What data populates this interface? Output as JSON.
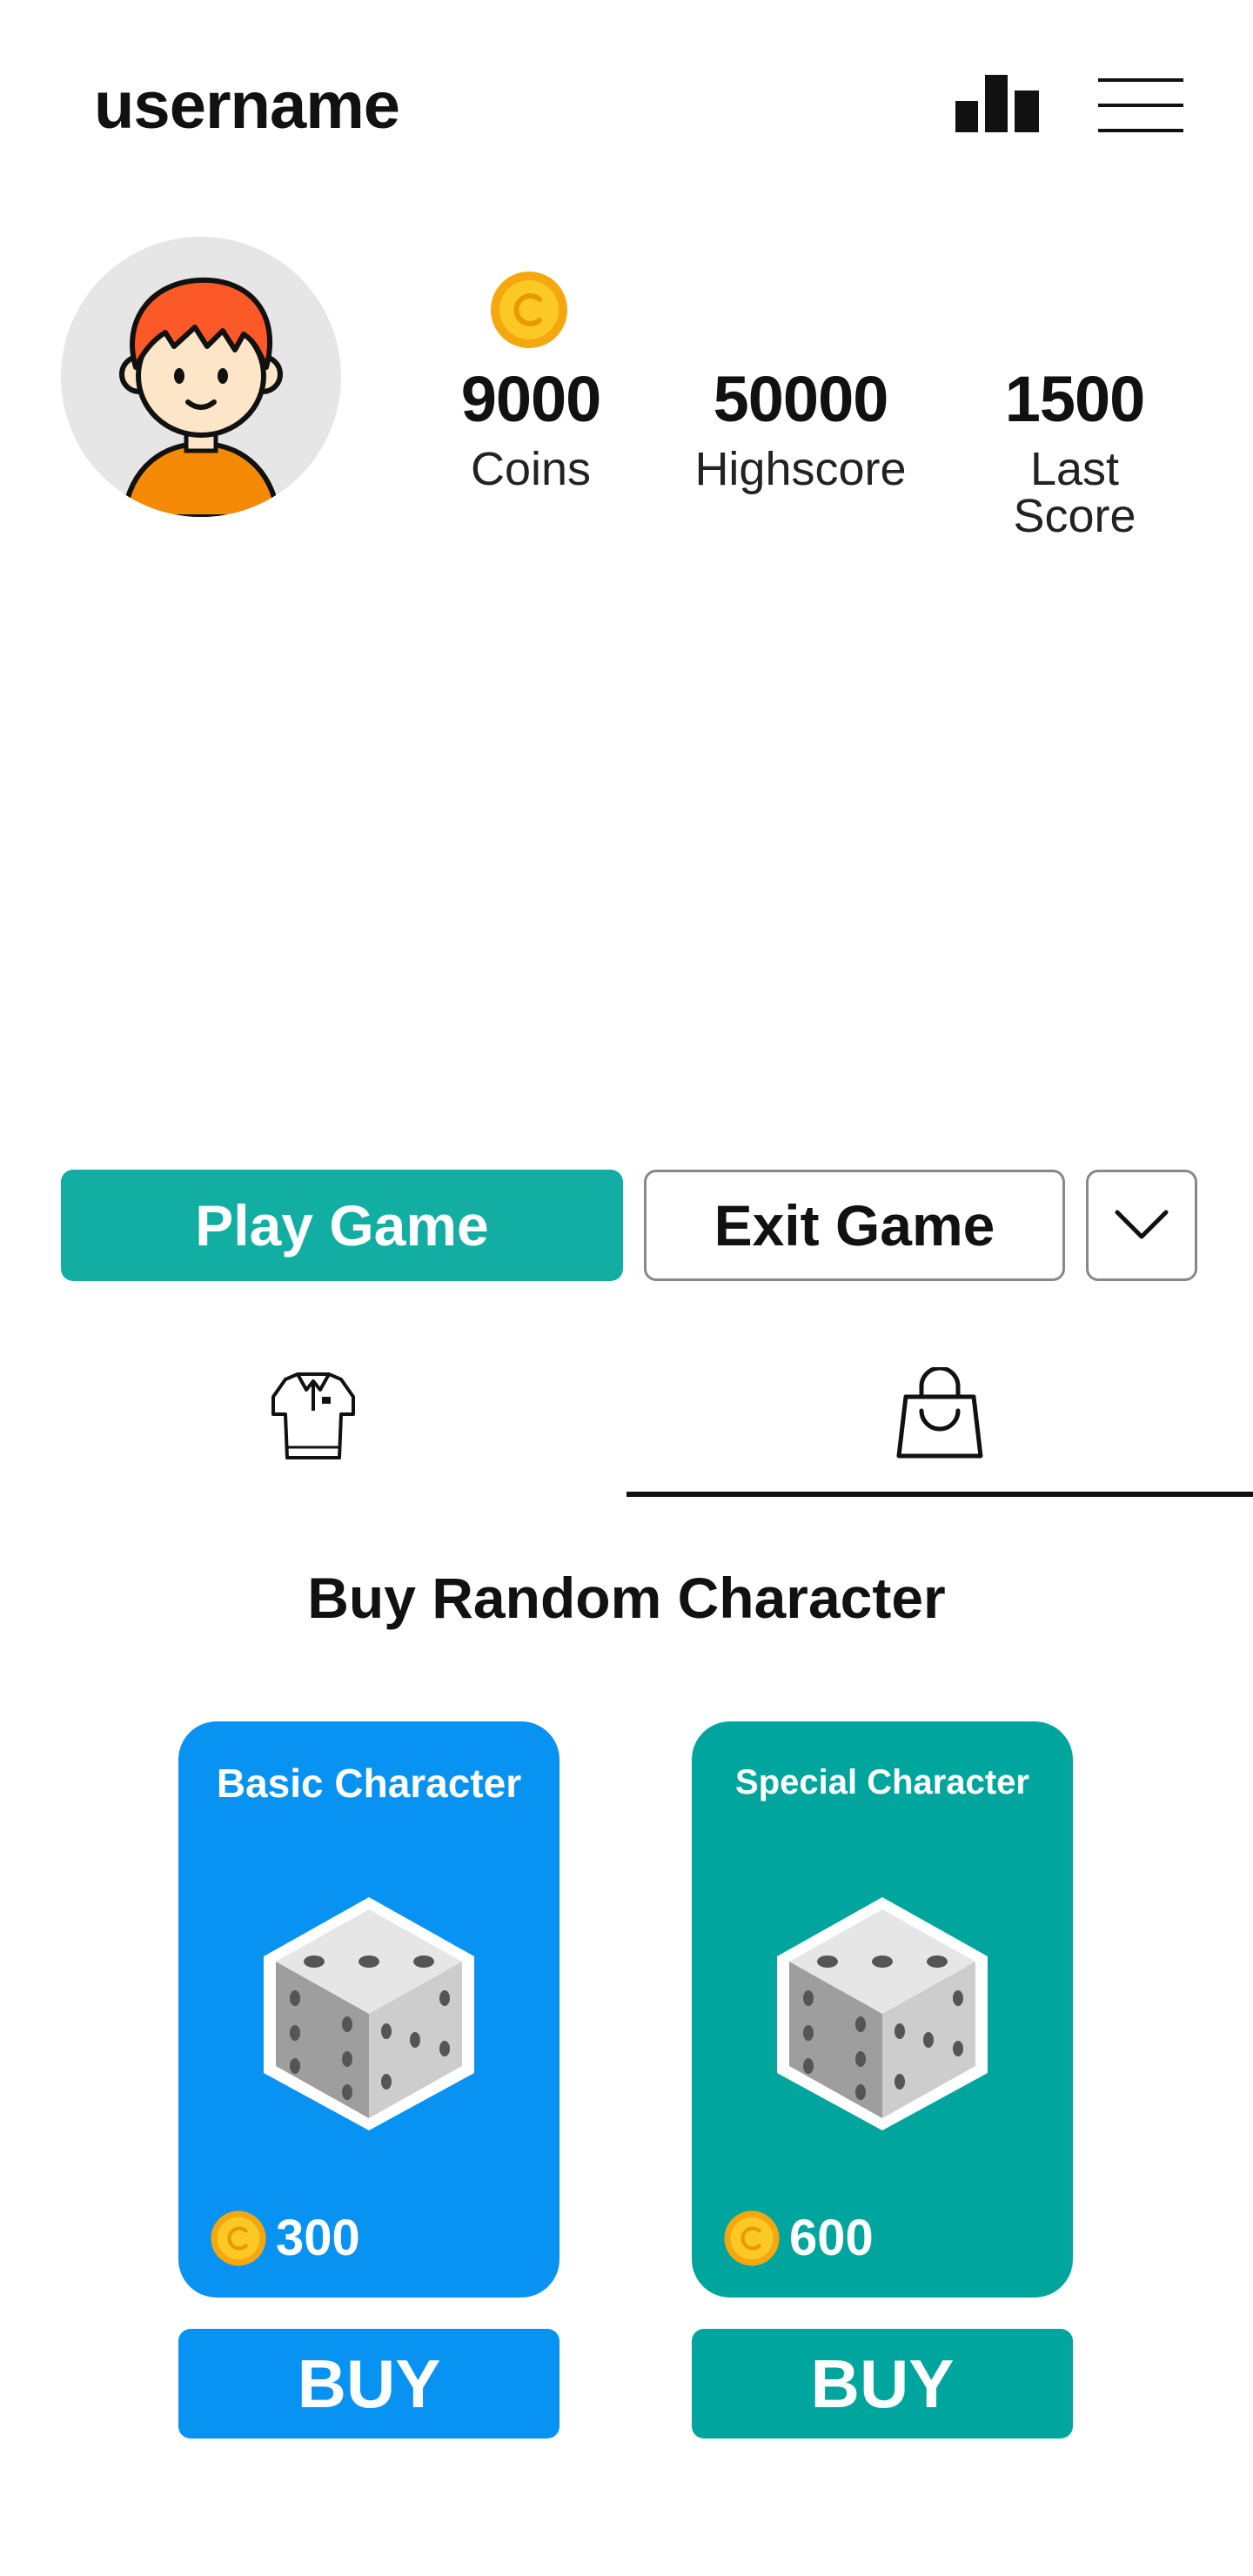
{
  "header": {
    "username": "username",
    "leaderboard_icon": "leaderboard-bar-chart-icon",
    "menu_icon": "hamburger-menu-icon"
  },
  "profile": {
    "avatar": "boy-avatar",
    "stats": {
      "coins": {
        "value": "9000",
        "label": "Coins"
      },
      "highscore": {
        "value": "50000",
        "label": "Highscore"
      },
      "last_score": {
        "value": "1500",
        "label": "Last Score"
      }
    }
  },
  "actions": {
    "play_label": "Play Game",
    "exit_label": "Exit Game",
    "dropdown_icon": "chevron-down-icon"
  },
  "tabs": [
    {
      "icon": "shirt-icon",
      "active": false
    },
    {
      "icon": "shopping-bag-icon",
      "active": true
    }
  ],
  "shop": {
    "title": "Buy Random Character",
    "cards": [
      {
        "title": "Basic Character",
        "price": "300",
        "buy_label": "BUY",
        "color": "#0892f2"
      },
      {
        "title": "Special Character",
        "price": "600",
        "buy_label": "BUY",
        "color": "#00a69d"
      }
    ]
  },
  "colors": {
    "primary_teal": "#12ada3",
    "basic_blue": "#0892f2",
    "special_teal": "#00a69d",
    "coin_gold": "#f5b51b"
  }
}
